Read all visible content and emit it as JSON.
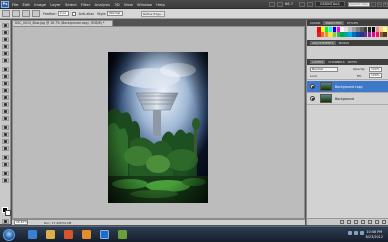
{
  "app": {
    "logo": "Ps"
  },
  "menu": [
    "File",
    "Edit",
    "Image",
    "Layer",
    "Select",
    "Filter",
    "Analysis",
    "3D",
    "View",
    "Window",
    "Help"
  ],
  "appbar": {
    "zoom": "66.7",
    "workspace": "ESSENTIALS",
    "search_placeholder": "Search Help"
  },
  "options": {
    "feather_label": "Feather:",
    "feather_value": "0 px",
    "antialias_label": "Anti-alias",
    "style_label": "Style:",
    "style_value": "Normal",
    "refine_edge": "Refine Edge..."
  },
  "document": {
    "tab_title": "DSC_0010_Blue.jpg @ 16.7% (Background copy, RGB/8) *",
    "zoom_field": "16.67%",
    "doc_size": "Doc: 17.2M/34.4M"
  },
  "panels": {
    "color_tabs": [
      "COLOR",
      "SWATCHES",
      "STYLES"
    ],
    "adjust_tabs": [
      "ADJUSTMENTS",
      "MASKS"
    ],
    "layer_tabs": [
      "LAYERS",
      "CHANNELS",
      "PATHS"
    ],
    "blend_mode": "Normal",
    "opacity_label": "Opacity:",
    "opacity_value": "100%",
    "lock_label": "Lock:",
    "fill_label": "Fill:",
    "fill_value": "100%",
    "layers": [
      {
        "name": "Background copy",
        "selected": true
      },
      {
        "name": "Background",
        "selected": false
      }
    ]
  },
  "swatch_colors": [
    "#ff0000",
    "#ffff00",
    "#00ff00",
    "#00ffff",
    "#0000ff",
    "#ff00ff",
    "#ffffff",
    "#e0e0e0",
    "#c0c0c0",
    "#a0a0a0",
    "#808080",
    "#606060",
    "#404040",
    "#202020",
    "#000000",
    "#ff8080",
    "#ffcc80",
    "#ffff80",
    "#ed1c24",
    "#f26522",
    "#f7941d",
    "#fff200",
    "#8dc63f",
    "#39b54a",
    "#00a651",
    "#00a99d",
    "#00aeef",
    "#0072bc",
    "#0054a6",
    "#2e3192",
    "#662d91",
    "#92278f",
    "#ec008c",
    "#ed145b",
    "#8c6239",
    "#603913"
  ],
  "taskbar": {
    "clock_time": "10:56 PM",
    "clock_date": "8/23/2012"
  }
}
